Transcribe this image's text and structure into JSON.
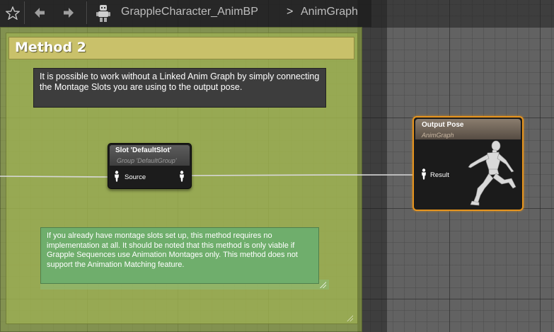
{
  "toolbar": {
    "favorite_icon": "star-icon",
    "back_icon": "arrow-left-icon",
    "forward_icon": "arrow-right-icon",
    "asset_icon": "robot-icon",
    "breadcrumb_asset": "GrappleCharacter_AnimBP",
    "breadcrumb_separator": ">",
    "breadcrumb_graph": "AnimGraph"
  },
  "comment": {
    "title": "Method 2",
    "color": "#a7bd54",
    "note_top": "It is possible to work without a Linked Anim Graph by simply connecting the Montage Slots you are using to the output pose.",
    "note_bottom": "If you already have montage slots set up, this method requires no implementation at all. It should be noted that this method is only viable if Grapple Sequences use Animation Montages only. This method does not support the Animation Matching feature."
  },
  "slot_node": {
    "title": "Slot 'DefaultSlot'",
    "subtitle": "Group 'DefaultGroup'",
    "input_pin": "Source",
    "pin_icon": "pose-pin-icon"
  },
  "output_node": {
    "title": "Output Pose",
    "subtitle": "AnimGraph",
    "input_pin": "Result",
    "preview_icon": "running-mannequin-icon",
    "accent": "#e8951d"
  }
}
